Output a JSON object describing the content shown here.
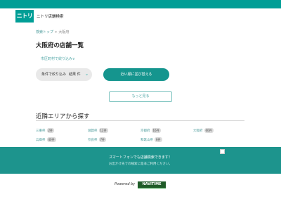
{
  "header": {
    "logo": "ニトリ",
    "title": "ニトリ店舗検索"
  },
  "breadcrumb": {
    "home": "検索トップ",
    "separator": ">",
    "current": "大阪府"
  },
  "page": {
    "title": "大阪府の店舗一覧",
    "filter_link": "市区町村で絞り込み"
  },
  "controls": {
    "filter_label": "条件で絞り込み",
    "result_label": "結果",
    "result_count": "件",
    "sort_label": "近い順に並び替える",
    "more_label": "もっと見る"
  },
  "nearby": {
    "title": "近隣エリアから探す",
    "areas": [
      {
        "name": "三重県",
        "count": "2件"
      },
      {
        "name": "滋賀県",
        "count": "12件"
      },
      {
        "name": "京都府",
        "count": "16件"
      },
      {
        "name": "大阪府",
        "count": "60件"
      },
      {
        "name": "兵庫県",
        "count": "40件"
      },
      {
        "name": "奈良県",
        "count": "7件"
      },
      {
        "name": "和歌山県",
        "count": "6件"
      }
    ]
  },
  "footer": {
    "main": "スマートフォンでも店舗検索できます！",
    "sub": "お出かけ先での検索に是非ご利用ください。"
  },
  "powered": {
    "label": "Powered by",
    "brand": "NAVITIME"
  },
  "colors": {
    "brand": "#009e96",
    "footer": "#1d948d",
    "navitime": "#1f5b28"
  }
}
